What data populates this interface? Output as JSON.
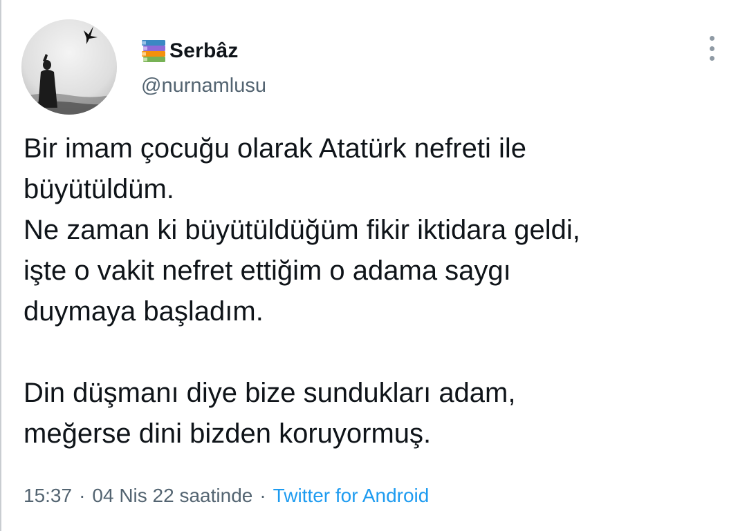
{
  "tweet": {
    "author": {
      "display_name": "Serbâz",
      "handle": "@nurnamlusu",
      "name_icon": "books-emoji-icon",
      "avatar_icon": "profile-photo-avatar"
    },
    "more_icon": "vertical-ellipsis-icon",
    "text_lines": {
      "l1": "Bir imam çocuğu olarak Atatürk nefreti ile",
      "l2": "büyütüldüm.",
      "l3": "Ne zaman ki büyütüldüğüm fikir iktidara geldi,",
      "l4": "işte o vakit nefret ettiğim o adama saygı",
      "l5": "duymaya başladım.",
      "l6": "Din düşmanı diye bize sundukları adam,",
      "l7": "meğerse dini bizden koruyormuş."
    },
    "meta": {
      "time": "15:37",
      "separator": "·",
      "date": "04 Nis 22 saatinde",
      "source": "Twitter for Android"
    },
    "colors": {
      "text": "#0f1419",
      "secondary": "#536471",
      "link": "#1d9bf0"
    }
  }
}
